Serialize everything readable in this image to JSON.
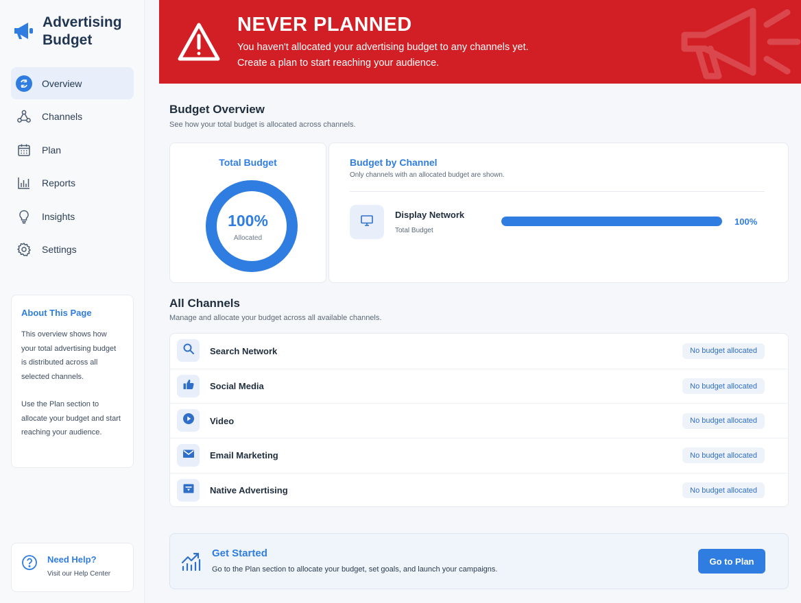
{
  "brand": {
    "title": "Advertising Budget"
  },
  "sidebar": {
    "items": [
      {
        "label": "Overview",
        "icon": "overview-icon",
        "active": true
      },
      {
        "label": "Channels",
        "icon": "channels-icon"
      },
      {
        "label": "Plan",
        "icon": "calendar-icon"
      },
      {
        "label": "Reports",
        "icon": "bar-chart-icon"
      },
      {
        "label": "Insights",
        "icon": "lightbulb-icon"
      },
      {
        "label": "Settings",
        "icon": "gear-icon"
      }
    ],
    "about": {
      "title": "About This Page",
      "paragraph1": "This overview shows how your total advertising budget is distributed across all selected channels.",
      "paragraph2": "Use the Plan section to allocate your budget and start reaching your audience."
    },
    "help": {
      "title": "Need Help?",
      "subtitle": "Visit our Help Center"
    }
  },
  "banner": {
    "title": "NEVER PLANNED",
    "line1": "You haven't allocated your advertising budget to any channels yet.",
    "line2": "Create a plan to start reaching your audience.",
    "color": "#d21f25"
  },
  "overview": {
    "title": "Budget Overview",
    "subtitle": "See how your total budget is allocated across channels.",
    "total": {
      "title": "Total Budget",
      "percent": "100%",
      "percent_value": 100,
      "label": "Allocated"
    },
    "by_channel": {
      "title": "Budget by Channel",
      "subtitle": "Only channels with an allocated budget are shown.",
      "items": [
        {
          "name": "Display Network",
          "sub": "Total Budget",
          "percent": "100%",
          "value": 100,
          "icon": "monitor-icon"
        }
      ]
    }
  },
  "channels": {
    "title": "All Channels",
    "subtitle": "Manage and allocate your budget across all available channels.",
    "items": [
      {
        "name": "Search Network",
        "status": "No budget allocated",
        "icon": "search-icon"
      },
      {
        "name": "Social Media",
        "status": "No budget allocated",
        "icon": "thumbs-up-icon"
      },
      {
        "name": "Video",
        "status": "No budget allocated",
        "icon": "play-icon"
      },
      {
        "name": "Email Marketing",
        "status": "No budget allocated",
        "icon": "envelope-icon"
      },
      {
        "name": "Native Advertising",
        "status": "No budget allocated",
        "icon": "native-ad-icon"
      }
    ]
  },
  "get_started": {
    "title": "Get Started",
    "text": "Go to the Plan section to allocate your budget, set goals, and launch your campaigns.",
    "button": "Go to Plan"
  },
  "colors": {
    "accent": "#2f7de1",
    "banner": "#d21f25",
    "text": "#1f2d3d"
  }
}
